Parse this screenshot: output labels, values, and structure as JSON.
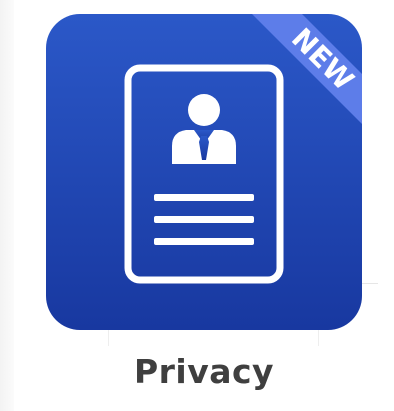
{
  "app": {
    "label": "Privacy",
    "badge": "NEW",
    "icon": "id-card-person-icon"
  },
  "colors": {
    "tile_top": "#2a55c4",
    "tile_bottom": "#1a3aa4",
    "badge": "#5b7be8",
    "icon_stroke": "#ffffff",
    "label": "#3f3f3f"
  }
}
